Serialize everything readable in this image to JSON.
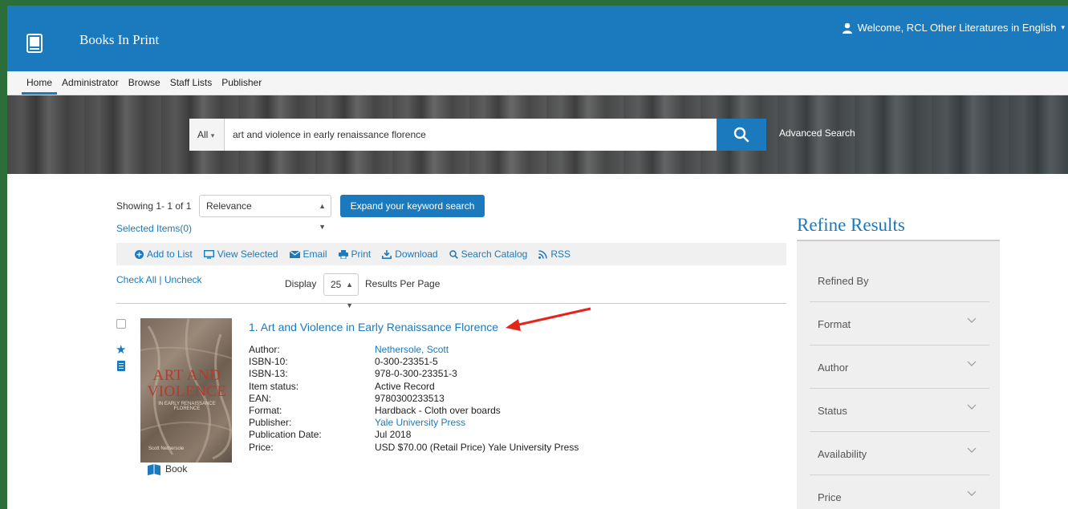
{
  "header": {
    "brand": "Books In Print",
    "welcome": "Welcome, RCL Other Literatures in English"
  },
  "nav": {
    "items": [
      "Home",
      "Administrator",
      "Browse",
      "Staff Lists",
      "Publisher"
    ],
    "active": "Home"
  },
  "search": {
    "scope": "All",
    "query": "art and violence in early renaissance florence",
    "advanced": "Advanced Search"
  },
  "results": {
    "showing": "Showing 1- 1 of 1",
    "sort": "Relevance",
    "expand_button": "Expand your keyword search",
    "selected_items": "Selected Items(0)",
    "toolbar": [
      "Add to List",
      "View Selected",
      "Email",
      "Print",
      "Download",
      "Search Catalog",
      "RSS"
    ],
    "check_all": "Check All",
    "uncheck": "Uncheck",
    "display_label": "Display",
    "per_page": "25",
    "per_page_label": "Results Per Page"
  },
  "item": {
    "title": "1. Art and Violence in Early Renaissance Florence",
    "cover_title": "ART AND VIOLENCE",
    "cover_subtitle": "IN EARLY RENAISSANCE FLORENCE",
    "cover_author": "Scott Nethersole",
    "format_badge": "Book",
    "fields": [
      {
        "label": "Author:",
        "value": "Nethersole, Scott",
        "link": true
      },
      {
        "label": "ISBN-10:",
        "value": "0-300-23351-5",
        "link": false
      },
      {
        "label": "ISBN-13:",
        "value": "978-0-300-23351-3",
        "link": false
      },
      {
        "label": "Item status:",
        "value": "Active Record",
        "link": false
      },
      {
        "label": "EAN:",
        "value": "9780300233513",
        "link": false
      },
      {
        "label": "Format:",
        "value": "Hardback - Cloth over boards",
        "link": false
      },
      {
        "label": "Publisher:",
        "value": "Yale University Press",
        "link": true
      },
      {
        "label": "Publication Date:",
        "value": "Jul 2018",
        "link": false
      },
      {
        "label": "Price:",
        "value": "USD $70.00 (Retail Price) Yale University Press",
        "link": false
      }
    ]
  },
  "refine": {
    "title": "Refine Results",
    "refined_by": "Refined By",
    "facets": [
      "Format",
      "Author",
      "Status",
      "Availability",
      "Price"
    ]
  },
  "colors": {
    "brand_blue": "#1b79bd",
    "frame_green": "#2b6e3a",
    "annotation_red": "#e8231c"
  }
}
